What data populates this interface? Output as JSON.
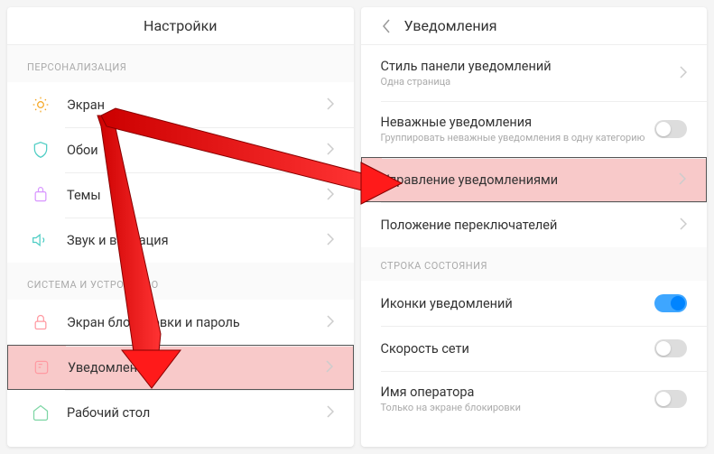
{
  "left": {
    "title": "Настройки",
    "sections": [
      {
        "header": "ПЕРСОНАЛИЗАЦИЯ",
        "items": [
          {
            "label": "Экран"
          },
          {
            "label": "Обои"
          },
          {
            "label": "Темы"
          },
          {
            "label": "Звук и вибрация"
          }
        ]
      },
      {
        "header": "СИСТЕМА И УСТРОЙСТВО",
        "items": [
          {
            "label": "Экран блокировки и пароль"
          },
          {
            "label": "Уведомления"
          },
          {
            "label": "Рабочий стол"
          }
        ]
      }
    ]
  },
  "right": {
    "title": "Уведомления",
    "items": [
      {
        "label": "Стиль панели уведомлений",
        "sub": "Одна страница",
        "trailing": "chev"
      },
      {
        "label": "Неважные уведомления",
        "sub": "Группировать неважные уведомления в одну категорию",
        "trailing": "toggle-off"
      },
      {
        "label": "Управление уведомлениями",
        "trailing": "chev"
      },
      {
        "label": "Положение переключателей",
        "trailing": "chev"
      }
    ],
    "section2": {
      "header": "СТРОКА СОСТОЯНИЯ",
      "items": [
        {
          "label": "Иконки уведомлений",
          "trailing": "toggle-on"
        },
        {
          "label": "Скорость сети",
          "trailing": "toggle-off"
        },
        {
          "label": "Имя оператора",
          "sub": "Только на экране блокировки",
          "trailing": "toggle-off"
        }
      ]
    }
  },
  "colors": {
    "highlight": "#f8c9c9",
    "arrow": "#ff0000",
    "toggle_on": "#0084ff"
  }
}
